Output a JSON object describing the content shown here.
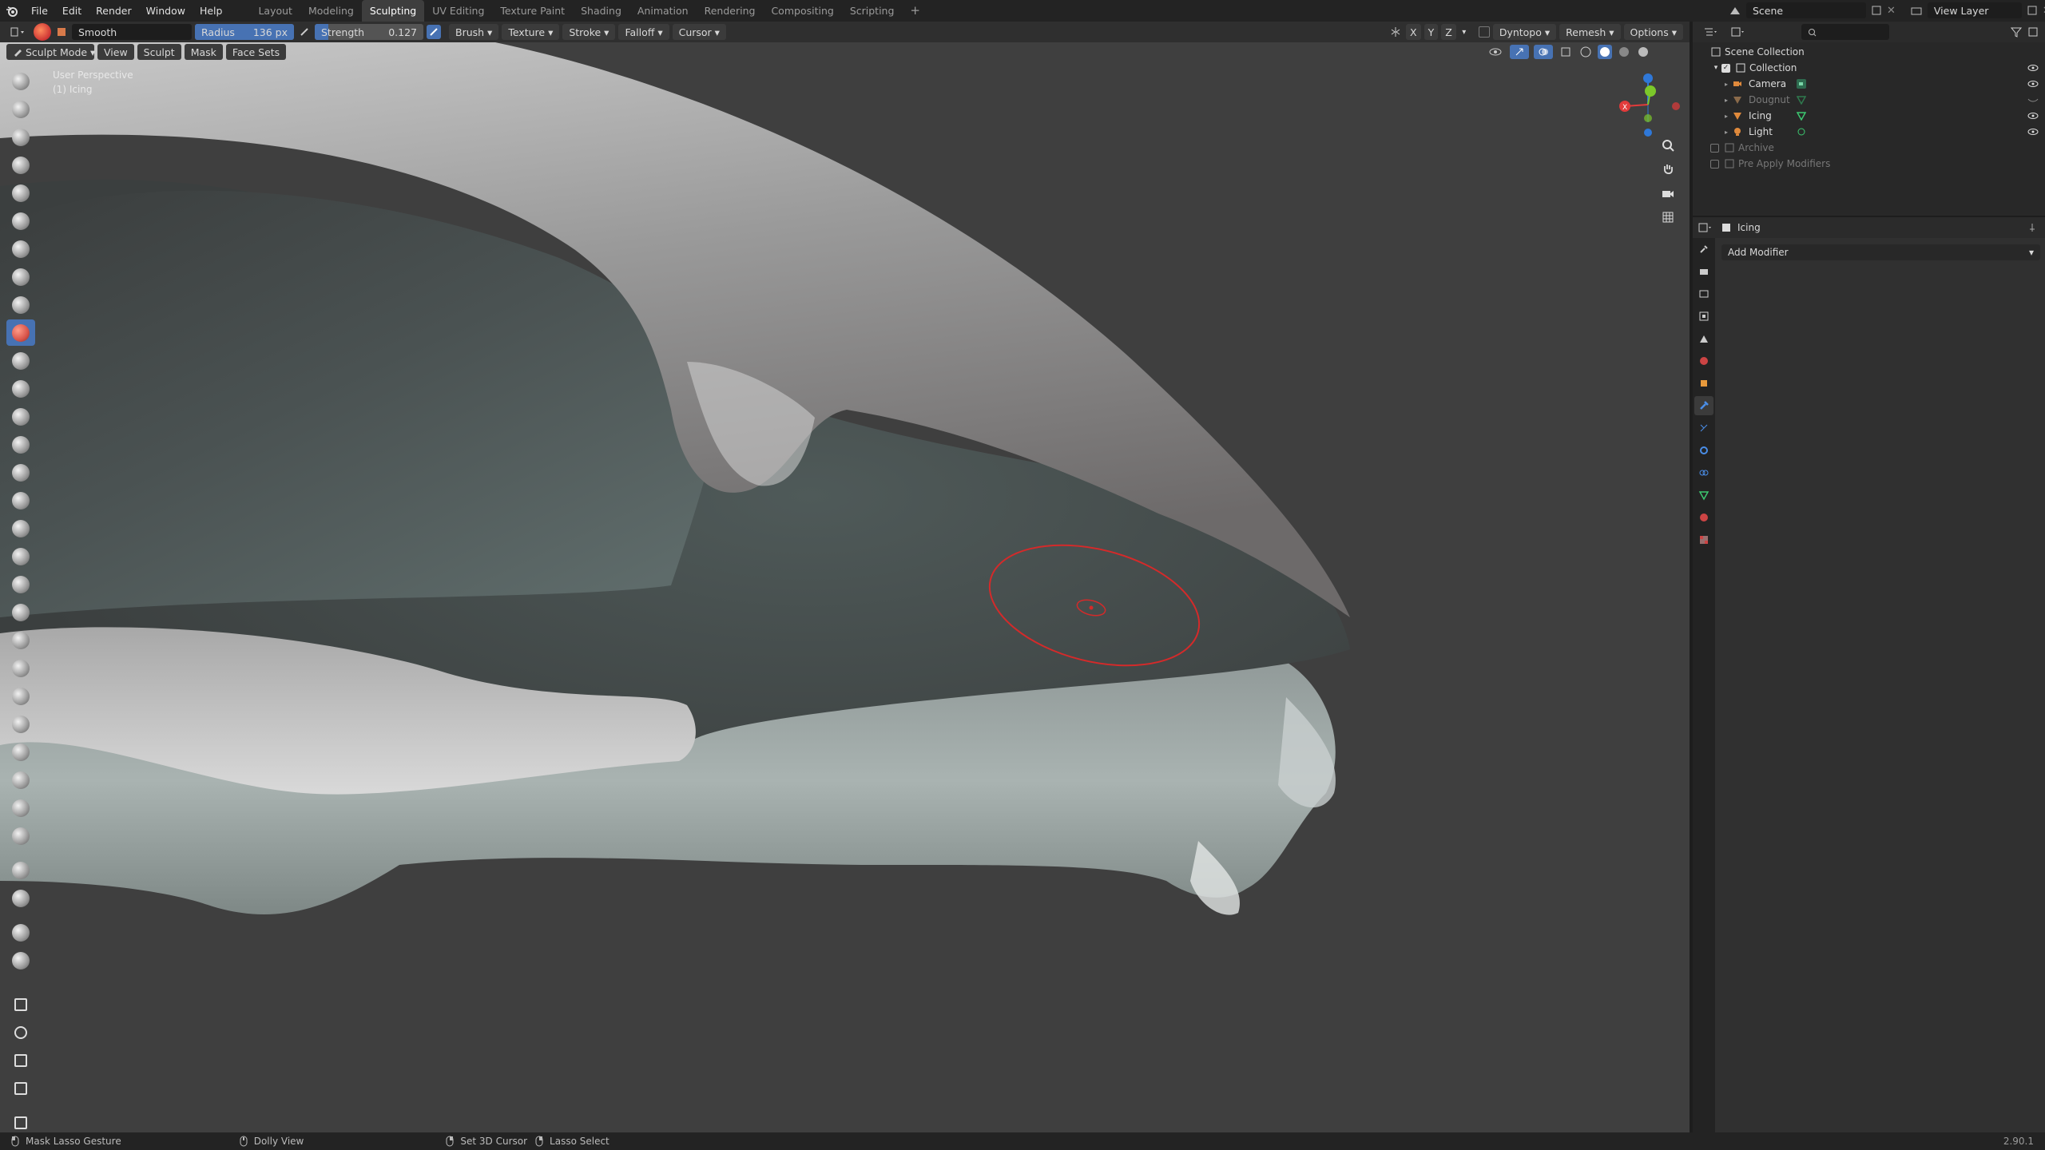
{
  "topbar": {
    "menus": [
      "File",
      "Edit",
      "Render",
      "Window",
      "Help"
    ],
    "workspace_tabs": [
      "Layout",
      "Modeling",
      "Sculpting",
      "UV Editing",
      "Texture Paint",
      "Shading",
      "Animation",
      "Rendering",
      "Compositing",
      "Scripting"
    ],
    "active_tab": "Sculpting",
    "add_tab_icon": "plus-icon",
    "scene_label": "Scene",
    "view_layer_label": "View Layer"
  },
  "tool_header": {
    "brush_name": "Smooth",
    "radius_label": "Radius",
    "radius_value": "136 px",
    "strength_label": "Strength",
    "strength_value": "0.127",
    "strength_fill": 0.127,
    "menus": [
      "Brush",
      "Texture",
      "Stroke",
      "Falloff",
      "Cursor"
    ],
    "axis_labels": [
      "X",
      "Y",
      "Z"
    ],
    "dyntopo_label": "Dyntopo",
    "remesh_label": "Remesh",
    "options_label": "Options"
  },
  "viewport_header": {
    "mode_label": "Sculpt Mode",
    "menus": [
      "View",
      "Sculpt",
      "Mask",
      "Face Sets"
    ]
  },
  "viewport": {
    "perspective_label": "User Perspective",
    "object_label": "(1) Icing"
  },
  "toolbar": {
    "tools": [
      "draw-brush",
      "draw-sharp-brush",
      "clay-brush",
      "clay-strips-brush",
      "clay-thumb-brush",
      "layer-brush",
      "inflate-brush",
      "blob-brush",
      "crease-brush",
      "smooth-brush",
      "flatten-brush",
      "fill-brush",
      "scrape-brush",
      "multiplane-scrape-brush",
      "pinch-brush",
      "grab-brush",
      "elastic-deform-brush",
      "snake-hook-brush",
      "thumb-brush",
      "pose-brush",
      "nudge-brush",
      "rotate-brush",
      "slide-relax-brush",
      "boundary-brush",
      "cloth-brush",
      "simplify-brush",
      "mask-brush",
      "draw-face-sets-brush",
      "box-mask-tool",
      "box-hide-tool",
      "mesh-filter-tool",
      "cloth-filter-tool",
      "move-tool",
      "rotate-tool",
      "scale-tool",
      "transform-tool",
      "annotate-tool"
    ],
    "active_index": 9
  },
  "outliner": {
    "search_placeholder": "",
    "root": "Scene Collection",
    "collection": "Collection",
    "items": [
      {
        "label": "Camera",
        "icon": "camera-icon",
        "visible": true,
        "dim": false
      },
      {
        "label": "Dougnut",
        "icon": "mesh-icon",
        "visible": false,
        "dim": true
      },
      {
        "label": "Icing",
        "icon": "mesh-icon",
        "visible": true,
        "dim": false
      },
      {
        "label": "Light",
        "icon": "light-icon",
        "visible": true,
        "dim": false
      }
    ],
    "extra_collections": [
      "Archive",
      "Pre Apply Modifiers"
    ]
  },
  "properties": {
    "object_name": "Icing",
    "add_modifier_label": "Add Modifier"
  },
  "statusbar": {
    "left_hint": "Mask Lasso Gesture",
    "middle_hint": "Dolly View",
    "right_hint_1": "Set 3D Cursor",
    "right_hint_2": "Lasso Select",
    "version": "2.90.1"
  },
  "colors": {
    "accent": "#4772b3",
    "brush_cursor": "#d42a2a",
    "viewport_bg": "#3f3f3f"
  }
}
